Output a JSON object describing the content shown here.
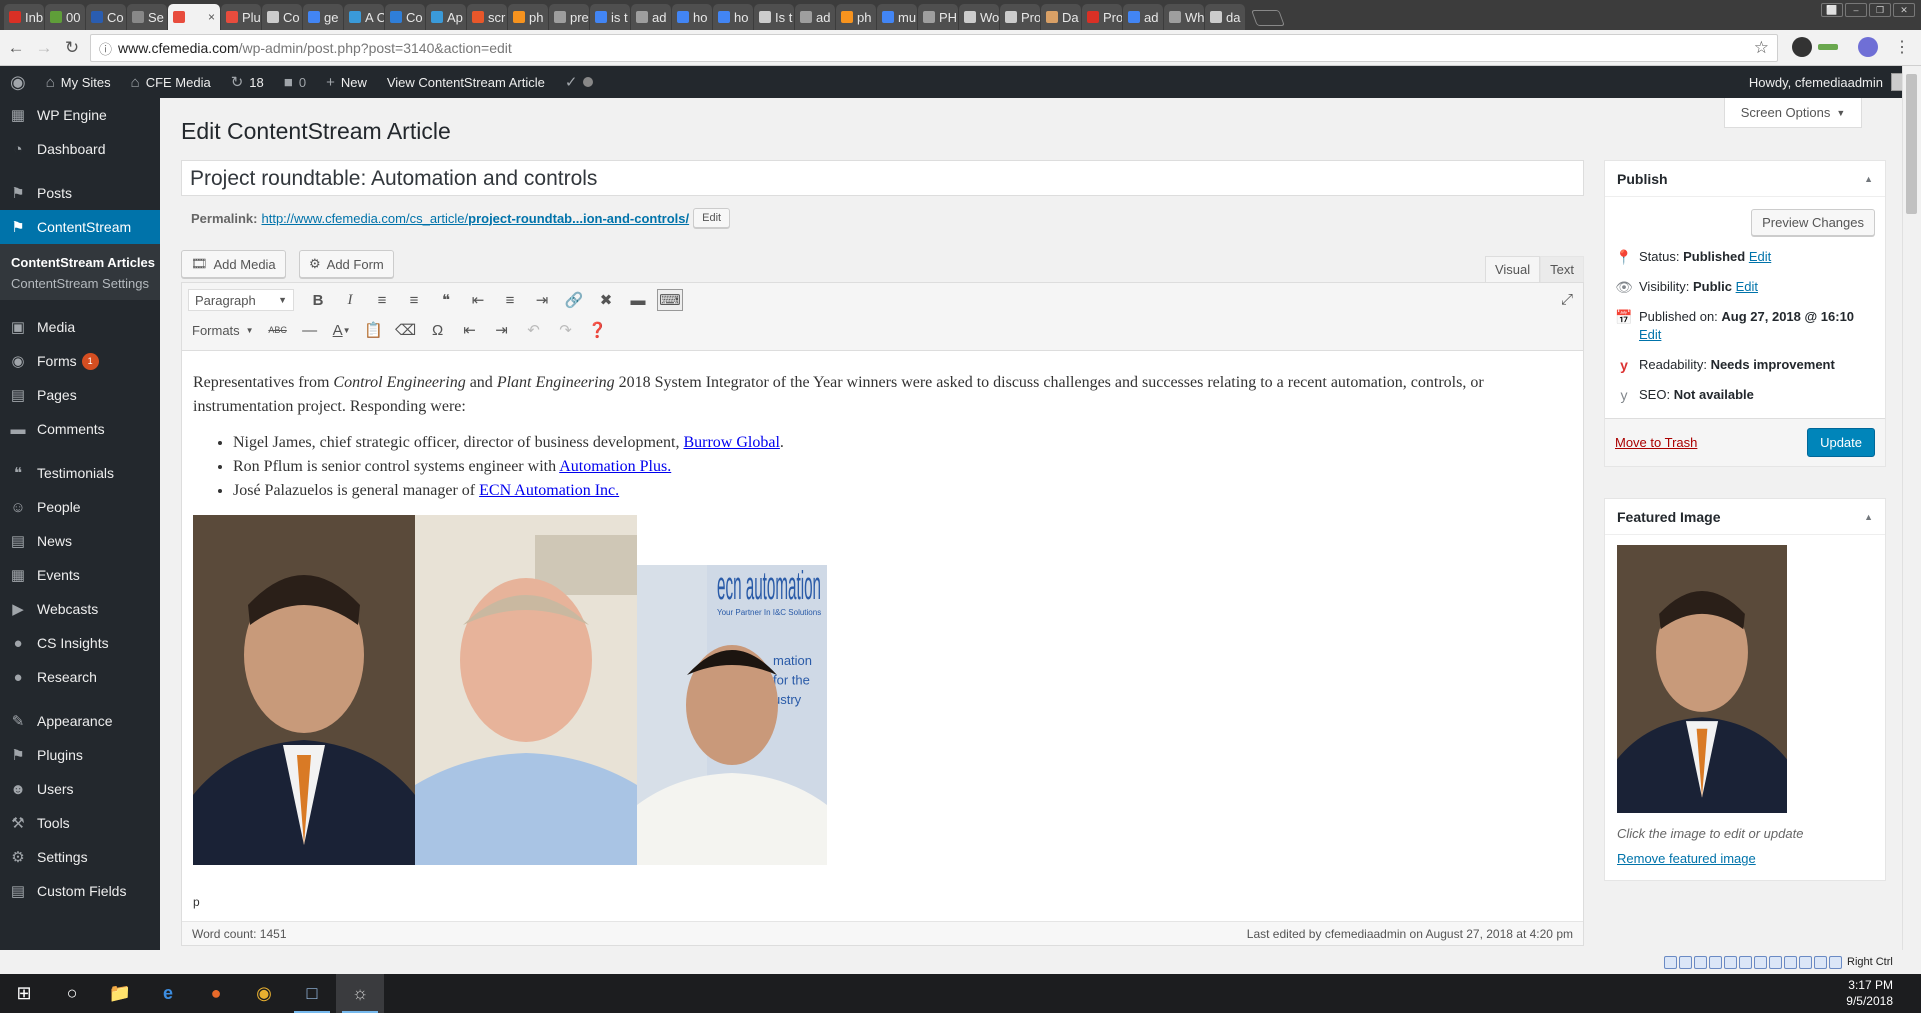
{
  "browser": {
    "tabs": [
      {
        "label": "Inb",
        "color": "#d93025"
      },
      {
        "label": "00",
        "color": "#5f9e39"
      },
      {
        "label": "Co",
        "color": "#2a5db0"
      },
      {
        "label": "Se",
        "color": "#888888"
      },
      {
        "label": "",
        "color": "#e84c3d",
        "active": true
      },
      {
        "label": "Plu",
        "color": "#e84c3d"
      },
      {
        "label": "Co",
        "color": "#cccccc"
      },
      {
        "label": "ge",
        "color": "#4285f4"
      },
      {
        "label": "A C",
        "color": "#3a9ad9"
      },
      {
        "label": "Co",
        "color": "#2f7ed8"
      },
      {
        "label": "Ap",
        "color": "#3a9ad9"
      },
      {
        "label": "scr",
        "color": "#e8572a"
      },
      {
        "label": "ph",
        "color": "#f7931e"
      },
      {
        "label": "pre",
        "color": "#9e9e9e"
      },
      {
        "label": "is t",
        "color": "#4285f4"
      },
      {
        "label": "ad",
        "color": "#9e9e9e"
      },
      {
        "label": "ho",
        "color": "#4285f4"
      },
      {
        "label": "ho",
        "color": "#4285f4"
      },
      {
        "label": "Is t",
        "color": "#cccccc"
      },
      {
        "label": "ad",
        "color": "#9e9e9e"
      },
      {
        "label": "ph",
        "color": "#f7931e"
      },
      {
        "label": "mu",
        "color": "#4285f4"
      },
      {
        "label": "PH",
        "color": "#9e9e9e"
      },
      {
        "label": "Wo",
        "color": "#cccccc"
      },
      {
        "label": "Pro",
        "color": "#cccccc"
      },
      {
        "label": "Da",
        "color": "#d9a066"
      },
      {
        "label": "Pro",
        "color": "#d93025"
      },
      {
        "label": "ad",
        "color": "#4285f4"
      },
      {
        "label": "Wh",
        "color": "#9e9e9e"
      },
      {
        "label": "da",
        "color": "#cccccc"
      }
    ],
    "tab_close": "×",
    "url_host": "www.cfemedia.com",
    "url_path": "/wp-admin/post.php?post=3140&action=edit",
    "window_controls": [
      "⬜",
      "–",
      "❐",
      "✕"
    ]
  },
  "adminbar": {
    "my_sites": "My Sites",
    "site_name": "CFE Media",
    "updates_count": "18",
    "comments_count": "0",
    "new_label": "New",
    "view_label": "View ContentStream Article",
    "howdy": "Howdy, cfemediaadmin"
  },
  "sidebar": {
    "items": [
      {
        "label": "WP Engine",
        "icon": "grid-icon"
      },
      {
        "label": "Dashboard",
        "icon": "dashboard-icon"
      },
      {
        "label": "Posts",
        "icon": "pushpin-icon"
      },
      {
        "label": "ContentStream",
        "icon": "pushpin-icon",
        "current": true
      },
      {
        "label": "Media",
        "icon": "media-icon"
      },
      {
        "label": "Forms",
        "icon": "forms-icon",
        "badge": "1"
      },
      {
        "label": "Pages",
        "icon": "pages-icon"
      },
      {
        "label": "Comments",
        "icon": "comments-icon"
      },
      {
        "label": "Testimonials",
        "icon": "quote-icon"
      },
      {
        "label": "People",
        "icon": "people-icon"
      },
      {
        "label": "News",
        "icon": "news-icon"
      },
      {
        "label": "Events",
        "icon": "calendar-icon"
      },
      {
        "label": "Webcasts",
        "icon": "video-icon"
      },
      {
        "label": "CS Insights",
        "icon": "lightbulb-icon"
      },
      {
        "label": "Research",
        "icon": "lightbulb-icon"
      },
      {
        "label": "Appearance",
        "icon": "brush-icon"
      },
      {
        "label": "Plugins",
        "icon": "plugin-icon"
      },
      {
        "label": "Users",
        "icon": "user-icon"
      },
      {
        "label": "Tools",
        "icon": "wrench-icon"
      },
      {
        "label": "Settings",
        "icon": "settings-icon"
      },
      {
        "label": "Custom Fields",
        "icon": "fields-icon"
      }
    ],
    "submenu": [
      "ContentStream Articles",
      "ContentStream Settings"
    ]
  },
  "page": {
    "screen_options": "Screen Options",
    "title": "Edit ContentStream Article",
    "post_title": "Project roundtable: Automation and controls",
    "permalink_label": "Permalink:",
    "permalink_base": "http://www.cfemedia.com/cs_article/",
    "permalink_slug": "project-roundtab...ion-and-controls/",
    "permalink_edit": "Edit",
    "add_media": "Add Media",
    "add_form": "Add Form",
    "tab_visual": "Visual",
    "tab_text": "Text",
    "format_select": "Paragraph",
    "formats_label": "Formats"
  },
  "content": {
    "intro_1": "Representatives from ",
    "em_1": "Control Engineering",
    "intro_2": " and ",
    "em_2": "Plant Engineering",
    "intro_3": " 2018 System Integrator of the Year winners were asked to discuss challenges and successes relating to a recent automation, controls, or instrumentation project. Responding were:",
    "bullets": [
      {
        "text": "Nigel James, chief strategic officer, director of business development, ",
        "link": "Burrow Global",
        "after": "."
      },
      {
        "text": "Ron Pflum is senior control systems engineer with ",
        "link": "Automation Plus.",
        "after": ""
      },
      {
        "text": "José Palazuelos is general manager of ",
        "link": "ECN Automation Inc.",
        "after": ""
      }
    ],
    "ecn_sign": "ecn automation",
    "ecn_sub": "Your Partner In I&C Solutions",
    "ecn_side": "mation\nfor the\nustry",
    "path": "p",
    "word_count": "Word count: 1451",
    "last_edited": "Last edited by cfemediaadmin on August 27, 2018 at 4:20 pm"
  },
  "publish": {
    "heading": "Publish",
    "preview": "Preview Changes",
    "status_label": "Status:",
    "status_value": "Published",
    "visibility_label": "Visibility:",
    "visibility_value": "Public",
    "published_label": "Published on:",
    "published_value": "Aug 27, 2018 @ 16:10",
    "readability_label": "Readability:",
    "readability_value": "Needs improvement",
    "seo_label": "SEO:",
    "seo_value": "Not available",
    "edit": "Edit",
    "trash": "Move to Trash",
    "update": "Update"
  },
  "featured": {
    "heading": "Featured Image",
    "note": "Click the image to edit or update",
    "remove": "Remove featured image"
  },
  "vm_status": {
    "host_key": "Right Ctrl"
  },
  "taskbar": {
    "time": "3:17 PM",
    "date": "9/5/2018"
  },
  "colors": {
    "wp_blue": "#0073aa",
    "admin_dark": "#23282d",
    "accent_red": "#dc3232"
  }
}
